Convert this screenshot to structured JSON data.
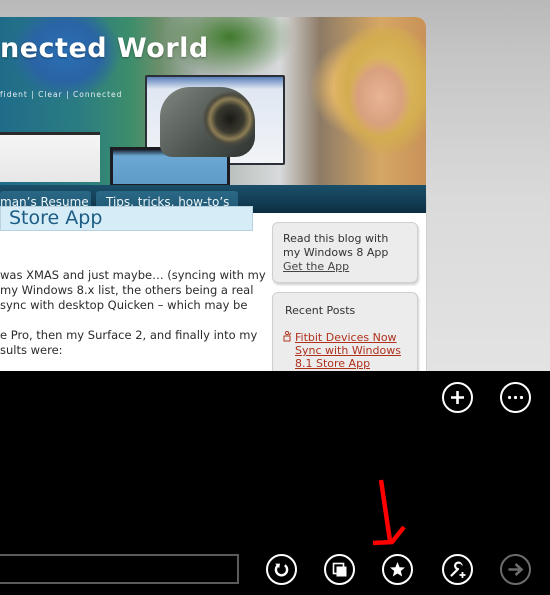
{
  "webpage": {
    "banner": {
      "title": "nected World",
      "tagline": "fident  |  Clear  |  Connected"
    },
    "nav_tabs": [
      {
        "label": "man’s Resume"
      },
      {
        "label": "Tips, tricks, how-to’s"
      }
    ],
    "post": {
      "title": "Store App",
      "paragraph1": [
        "was XMAS and just maybe… (syncing with my",
        "my Windows 8.x list, the others being a real",
        "sync with desktop Quicken – which may be"
      ],
      "paragraph2": [
        "e Pro, then my Surface 2, and finally into my",
        "sults were:"
      ]
    },
    "sidebar": {
      "app_box": {
        "line1": "Read this blog with",
        "line2": "my Windows 8 App",
        "link": "Get the App"
      },
      "recent_posts": {
        "heading": "Recent Posts",
        "items": [
          {
            "lines": [
              "Fitbit Devices Now",
              "Sync with Windows",
              "8.1 Store App"
            ],
            "icon": "rss-person-icon"
          }
        ]
      }
    }
  },
  "app_bar": {
    "top_buttons": [
      {
        "name": "new-tab-button",
        "icon": "plus-icon"
      },
      {
        "name": "tab-options-button",
        "icon": "ellipsis-icon"
      }
    ],
    "address_bar": {
      "value": "",
      "placeholder": ""
    },
    "bottom_buttons": [
      {
        "name": "refresh-button",
        "icon": "refresh-icon",
        "enabled": true
      },
      {
        "name": "pin-to-start-button",
        "icon": "pin-icon",
        "enabled": true
      },
      {
        "name": "favorites-button",
        "icon": "star-icon",
        "enabled": true,
        "highlighted": true
      },
      {
        "name": "page-tools-button",
        "icon": "wrench-plus-icon",
        "enabled": true
      },
      {
        "name": "forward-button",
        "icon": "arrow-right-icon",
        "enabled": false
      }
    ],
    "annotation": {
      "color": "#ff0000",
      "points_to": "favorites-button"
    }
  }
}
